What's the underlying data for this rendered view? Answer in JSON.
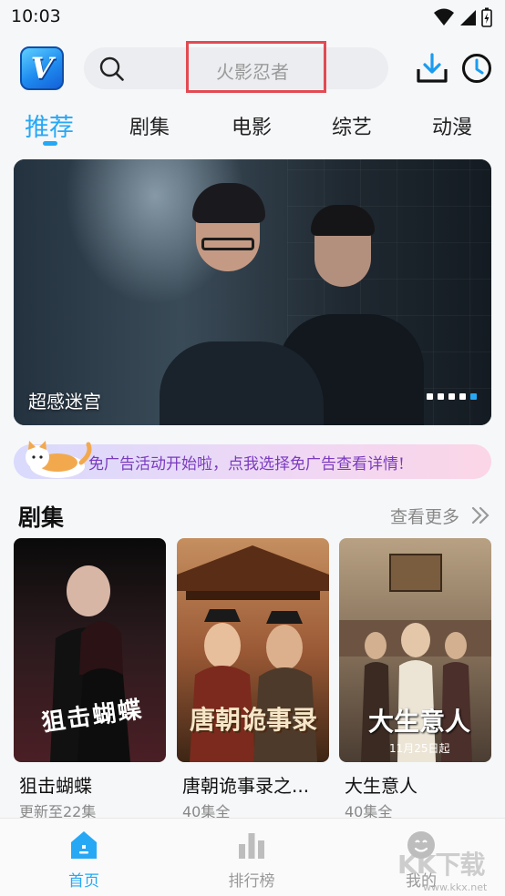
{
  "status_bar": {
    "time": "10:03"
  },
  "header": {
    "logo_letter": "V",
    "search_placeholder": "火影忍者"
  },
  "tabs": [
    {
      "label": "推荐",
      "active": true
    },
    {
      "label": "剧集",
      "active": false
    },
    {
      "label": "电影",
      "active": false
    },
    {
      "label": "综艺",
      "active": false
    },
    {
      "label": "动漫",
      "active": false
    }
  ],
  "banner": {
    "caption": "超感迷宫",
    "dot_count": 5,
    "active_dot": 4
  },
  "ad_strip": {
    "text": "免广告活动开始啦，点我选择免广告查看详情!"
  },
  "section": {
    "title": "剧集",
    "more_label": "查看更多"
  },
  "cards": [
    {
      "title": "狙击蝴蝶",
      "subtitle": "更新至22集",
      "poster_text": "狙击蝴蝶"
    },
    {
      "title": "唐朝诡事录之...",
      "subtitle": "40集全",
      "poster_text": "唐朝诡事录"
    },
    {
      "title": "大生意人",
      "subtitle": "40集全",
      "poster_text": "大生意人",
      "poster_date": "11月25日起"
    }
  ],
  "bottom_nav": [
    {
      "label": "首页",
      "active": true,
      "icon": "home-icon"
    },
    {
      "label": "排行榜",
      "active": false,
      "icon": "ranking-icon"
    },
    {
      "label": "我的",
      "active": false,
      "icon": "profile-icon"
    }
  ],
  "watermark": {
    "text": "KK下载",
    "url": "www.kkx.net"
  },
  "colors": {
    "accent": "#27a8f5",
    "highlight_border": "#e34a52",
    "ad_text": "#7a3bbf"
  }
}
